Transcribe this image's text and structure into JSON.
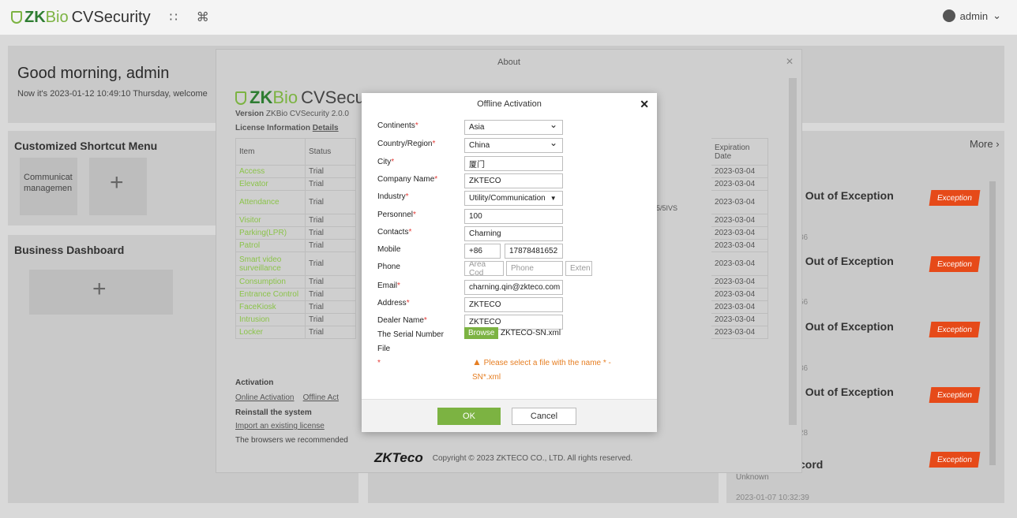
{
  "app": {
    "brand_zk": "ZK",
    "brand_bio": "Bio",
    "brand_rest": "CVSecurity",
    "user": "admin"
  },
  "welcome": {
    "title": "Good morning, admin",
    "subtitle": "Now it's 2023-01-12 10:49:10 Thursday, welcome"
  },
  "shortcut": {
    "title": "Customized Shortcut Menu",
    "tile_label": "Communicat managemen"
  },
  "business": {
    "title": "Business Dashboard"
  },
  "about": {
    "title": "About",
    "logo_zk": "ZK",
    "logo_bio": "Bio",
    "logo_cv": "CVSecu",
    "version_label": "Version",
    "version_value": "ZKBio CVSecurity 2.0.0",
    "license_label": "License Information",
    "details": "Details",
    "col_item": "Item",
    "col_status": "Status",
    "col_expiration": "Expiration Date",
    "rows": [
      {
        "item": "Access",
        "status": "Trial",
        "date": "2023-03-04"
      },
      {
        "item": "Elevator",
        "status": "Trial",
        "date": "2023-03-04"
      },
      {
        "item": "Attendance",
        "status": "Trial",
        "date": "2023-03-04"
      },
      {
        "item": "Visitor",
        "status": "Trial",
        "date": "2023-03-04"
      },
      {
        "item": "Parking(LPR)",
        "status": "Trial",
        "date": "2023-03-04"
      },
      {
        "item": "Patrol",
        "status": "Trial",
        "date": "2023-03-04"
      },
      {
        "item": "Smart video surveillance",
        "status": "Trial",
        "date": "2023-03-04"
      },
      {
        "item": "Consumption",
        "status": "Trial",
        "date": "2023-03-04"
      },
      {
        "item": "Entrance Control",
        "status": "Trial",
        "date": "2023-03-04"
      },
      {
        "item": "FaceKiosk",
        "status": "Trial",
        "date": "2023-03-04"
      },
      {
        "item": "Intrusion",
        "status": "Trial",
        "date": "2023-03-04"
      },
      {
        "item": "Locker",
        "status": "Trial",
        "date": "2023-03-04"
      }
    ],
    "middle_note": "; 5/5IVS",
    "activation": "Activation",
    "online": "Online Activation",
    "offline": "Offline Act",
    "reinstall": "Reinstall the system",
    "import": "Import an existing license",
    "browsers": "The browsers we recommended",
    "copyright": "Copyright © 2023 ZKTECO CO., LTD. All rights reserved.",
    "footer_logo": "ZKTeco"
  },
  "right_panel": {
    "more": "More",
    "events": [
      "l Out of Exception",
      "l Out of Exception",
      "l Out of Exception",
      "l Out of Exception",
      "cord"
    ],
    "badge": "Exception",
    "times": [
      "36",
      "56",
      "36",
      "28"
    ],
    "unknown": "Unknown",
    "last_time": "2023-01-07 10:32:39"
  },
  "dialog": {
    "title": "Offline Activation",
    "fields": {
      "continents": {
        "label": "Continents",
        "value": "Asia"
      },
      "country": {
        "label": "Country/Region",
        "value": "China"
      },
      "city": {
        "label": "City",
        "value": "厦门"
      },
      "company": {
        "label": "Company Name",
        "value": "ZKTECO"
      },
      "industry": {
        "label": "Industry",
        "value": "Utility/Communication"
      },
      "personnel": {
        "label": "Personnel",
        "value": "100"
      },
      "contacts": {
        "label": "Contacts",
        "value": "Charning"
      },
      "mobile": {
        "label": "Mobile",
        "code": "+86",
        "value": "17878481652"
      },
      "phone": {
        "label": "Phone",
        "area_ph": "Area Cod",
        "phone_ph": "Phone",
        "ext_ph": "Exten"
      },
      "email": {
        "label": "Email",
        "value": "charning.qin@zkteco.com"
      },
      "address": {
        "label": "Address",
        "value": "ZKTECO"
      },
      "dealer": {
        "label": "Dealer Name",
        "value": "ZKTECO"
      },
      "serial": {
        "label": "The Serial Number File",
        "browse": "Browse",
        "file": "ZKTECO-SN.xml"
      }
    },
    "warning": "Please select a file with the name * -SN*.xml",
    "ok": "OK",
    "cancel": "Cancel"
  }
}
